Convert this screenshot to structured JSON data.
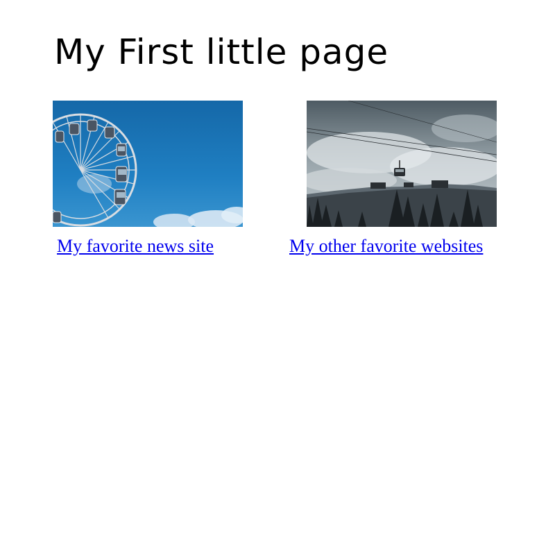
{
  "page": {
    "title": "My First little page"
  },
  "cards": [
    {
      "image_subject": "ferris wheel against blue sky",
      "link_text": "My favorite news site"
    },
    {
      "image_subject": "cable car over snowy mountain with trees",
      "link_text": "My other favorite websites"
    }
  ],
  "colors": {
    "link": "#0000ee",
    "text": "#000000",
    "background": "#ffffff"
  }
}
